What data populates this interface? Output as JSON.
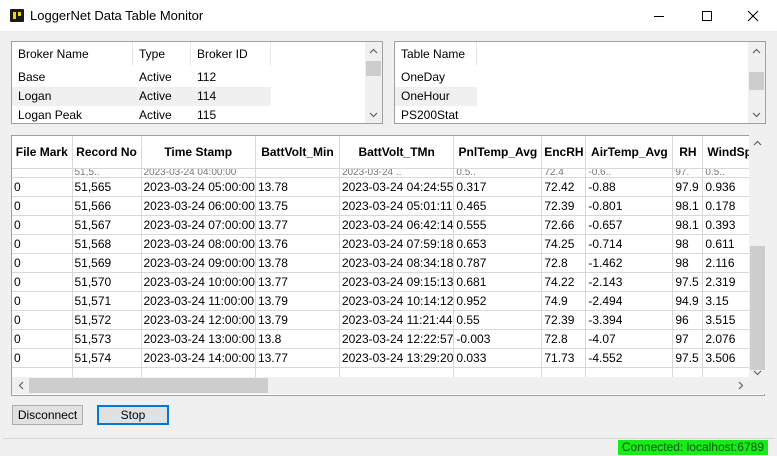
{
  "window": {
    "title": "LoggerNet Data Table Monitor"
  },
  "brokers": {
    "headers": [
      "Broker Name",
      "Type",
      "Broker ID"
    ],
    "rows": [
      [
        "Base",
        "Active",
        "112"
      ],
      [
        "Logan",
        "Active",
        "114"
      ],
      [
        "Logan Peak",
        "Active",
        "115"
      ]
    ],
    "selected_index": 1
  },
  "tables": {
    "header": "Table Name",
    "rows": [
      "OneDay",
      "OneHour",
      "PS200Stat"
    ],
    "selected_index": 1
  },
  "grid": {
    "columns": [
      "File Mark",
      "Record No",
      "Time Stamp",
      "BattVolt_Min",
      "BattVolt_TMn",
      "PnlTemp_Avg",
      "EncRH",
      "AirTemp_Avg",
      "RH",
      "WindSp"
    ],
    "partial_row": [
      "",
      "51,5..",
      "2023-03-24 04:00:00",
      "",
      "2023-03-24 ..",
      "0.5..",
      "72.4",
      "-0.6..",
      "97.",
      "0.5.."
    ],
    "rows": [
      [
        "0",
        "51,565",
        "2023-03-24 05:00:00",
        "13.78",
        "2023-03-24 04:24:55",
        "0.317",
        "72.42",
        "-0.88",
        "97.9",
        "0.936"
      ],
      [
        "0",
        "51,566",
        "2023-03-24 06:00:00",
        "13.75",
        "2023-03-24 05:01:11",
        "0.465",
        "72.39",
        "-0.801",
        "98.1",
        "0.178"
      ],
      [
        "0",
        "51,567",
        "2023-03-24 07:00:00",
        "13.77",
        "2023-03-24 06:42:14",
        "0.555",
        "72.66",
        "-0.657",
        "98.1",
        "0.393"
      ],
      [
        "0",
        "51,568",
        "2023-03-24 08:00:00",
        "13.76",
        "2023-03-24 07:59:18",
        "0.653",
        "74.25",
        "-0.714",
        "98",
        "0.611"
      ],
      [
        "0",
        "51,569",
        "2023-03-24 09:00:00",
        "13.78",
        "2023-03-24 08:34:18",
        "0.787",
        "72.8",
        "-1.462",
        "98",
        "2.116"
      ],
      [
        "0",
        "51,570",
        "2023-03-24 10:00:00",
        "13.77",
        "2023-03-24 09:15:13",
        "0.681",
        "74.22",
        "-2.143",
        "97.5",
        "2.319"
      ],
      [
        "0",
        "51,571",
        "2023-03-24 11:00:00",
        "13.79",
        "2023-03-24 10:14:12",
        "0.952",
        "74.9",
        "-2.494",
        "94.9",
        "3.15"
      ],
      [
        "0",
        "51,572",
        "2023-03-24 12:00:00",
        "13.79",
        "2023-03-24 11:21:44",
        "0.55",
        "72.39",
        "-3.394",
        "96",
        "3.515"
      ],
      [
        "0",
        "51,573",
        "2023-03-24 13:00:00",
        "13.8",
        "2023-03-24 12:22:57",
        "-0.003",
        "72.8",
        "-4.07",
        "97",
        "2.076"
      ],
      [
        "0",
        "51,574",
        "2023-03-24 14:00:00",
        "13.77",
        "2023-03-24 13:29:20",
        "0.033",
        "71.73",
        "-4.552",
        "97.5",
        "3.506"
      ]
    ]
  },
  "buttons": {
    "disconnect": "Disconnect",
    "stop": "Stop"
  },
  "status": {
    "connection": "Connected: localhost:6789",
    "connection_color": "#19ea19"
  },
  "icons": [
    "app-icon",
    "minimize-icon",
    "maximize-icon",
    "close-icon",
    "scroll-up-icon",
    "scroll-down-icon",
    "scroll-left-icon",
    "scroll-right-icon"
  ]
}
